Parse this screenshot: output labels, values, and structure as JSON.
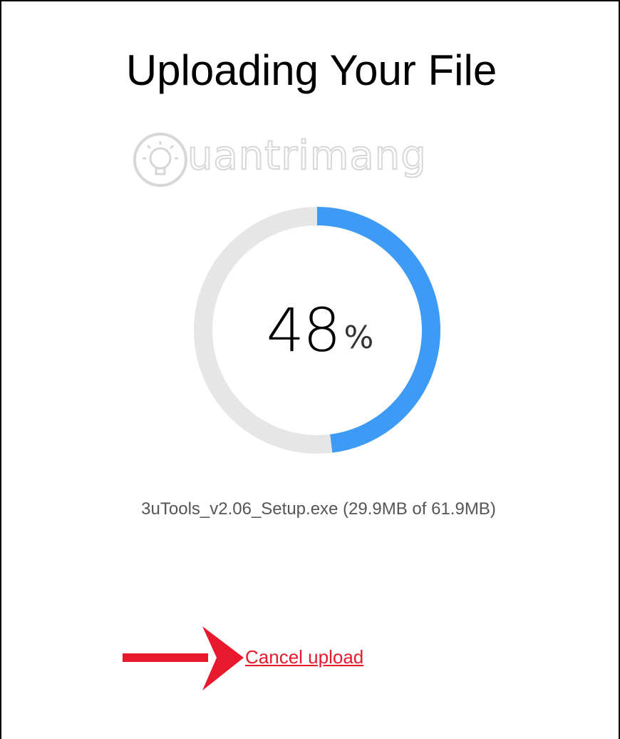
{
  "dialog": {
    "title": "Uploading Your File"
  },
  "watermark": {
    "text": "uantrimang",
    "icon": "lightbulb-icon"
  },
  "progress": {
    "percent": 48,
    "number_text": "48",
    "unit": "%",
    "track_color": "#e6e6e6",
    "fill_color": "#3d9bf5"
  },
  "file": {
    "info": "3uTools_v2.06_Setup.exe (29.9MB of 61.9MB)"
  },
  "actions": {
    "cancel_label": "Cancel upload",
    "cancel_color": "#e8192c"
  },
  "annotation": {
    "arrow_icon": "arrow-right-icon",
    "arrow_color": "#e8192c"
  }
}
